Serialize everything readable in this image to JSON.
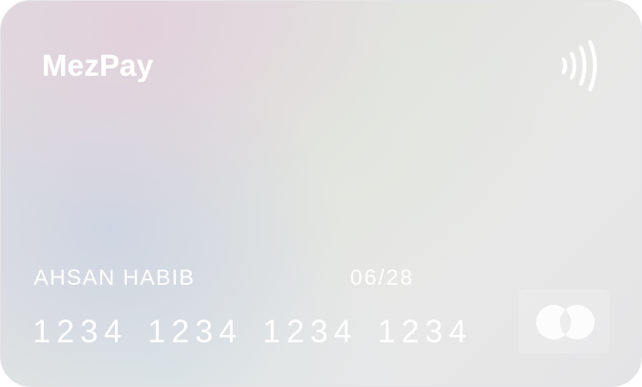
{
  "card": {
    "brand": "MezPay",
    "holder_name": "AHSAN HABIB",
    "expiry": "06/28",
    "number": "1234 1234 1234 1234",
    "icons": {
      "contactless": "contactless-icon",
      "network": "card-network-logo-icon"
    }
  }
}
